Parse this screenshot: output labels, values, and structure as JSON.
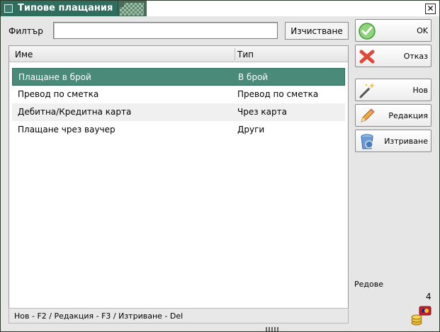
{
  "window": {
    "title": "Типове плащания",
    "close_glyph": "✕"
  },
  "filter": {
    "label": "Филтър",
    "value": "",
    "placeholder": "",
    "clear_label": "Изчистване"
  },
  "table": {
    "columns": [
      "Име",
      "Тип"
    ],
    "rows": [
      {
        "name": "Плащане в брой",
        "type": "В брой",
        "selected": true
      },
      {
        "name": "Превод по сметка",
        "type": "Превод по сметка",
        "selected": false
      },
      {
        "name": "Дебитна/Кредитна карта",
        "type": "Чрез карта",
        "selected": false
      },
      {
        "name": "Плащане чрез ваучер",
        "type": "Други",
        "selected": false
      }
    ]
  },
  "hint": "Нов - F2 / Редакция - F3 / Изтриване - Del",
  "buttons": {
    "ok": {
      "label": "OK",
      "icon": "check-circle-icon"
    },
    "cancel": {
      "label": "Отказ",
      "icon": "red-x-icon"
    },
    "new": {
      "label": "Нов",
      "icon": "magic-wand-icon"
    },
    "edit": {
      "label": "Редакция",
      "icon": "pencil-icon"
    },
    "delete": {
      "label": "Изтриване",
      "icon": "recycle-bin-icon"
    }
  },
  "status": {
    "rows_label": "Редове",
    "rows_count": "4",
    "icon": "coins-icon"
  },
  "colors": {
    "selection": "#4a8a78",
    "title_bar": "#2f6d5f"
  }
}
